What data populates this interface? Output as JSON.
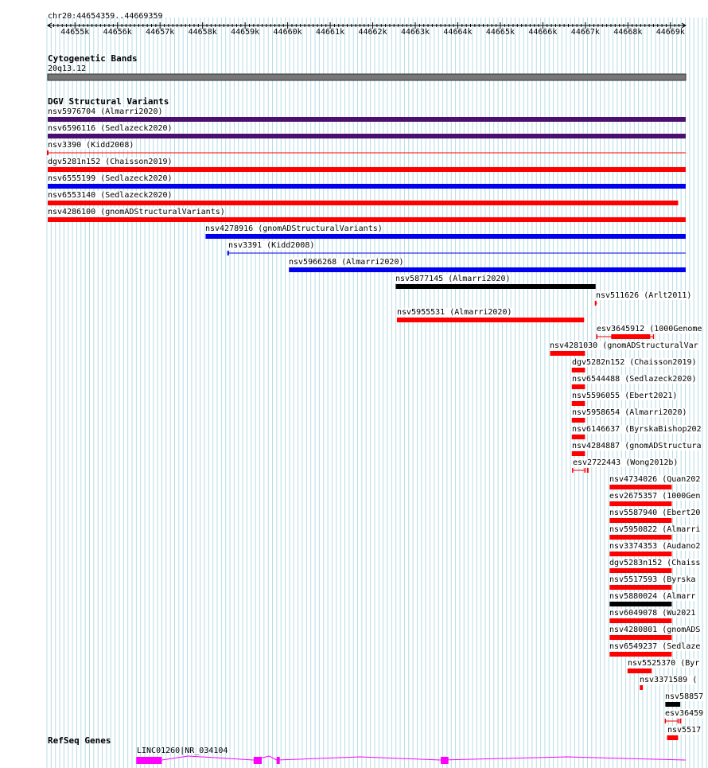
{
  "ruler": {
    "locus": "chr20:44654359..44669359",
    "start": 44654359,
    "end": 44669359,
    "ticks": [
      "44655k",
      "44656k",
      "44657k",
      "44658k",
      "44659k",
      "44660k",
      "44661k",
      "44662k",
      "44663k",
      "44664k",
      "44665k",
      "44666k",
      "44667k",
      "44668k",
      "44669k"
    ]
  },
  "cytobands": {
    "title": "Cytogenetic Bands",
    "band": "20q13.12"
  },
  "dgv": {
    "title": "DGV Structural Variants",
    "features": [
      {
        "label": "nsv5976704 (Almarri2020)",
        "color": "#4b0f70",
        "kind": "bar",
        "start": 44654359,
        "end": 44669359
      },
      {
        "label": "nsv6596116 (Sedlazeck2020)",
        "color": "#4b0f70",
        "kind": "bar",
        "start": 44654359,
        "end": 44669359
      },
      {
        "label": "nsv3390 (Kidd2008)",
        "color": "#ff0000",
        "kind": "line",
        "start": 44654359,
        "end": 44669359
      },
      {
        "label": "dgv5281n152 (Chaisson2019)",
        "color": "#ff0000",
        "kind": "bar",
        "start": 44654359,
        "end": 44669359
      },
      {
        "label": "nsv6555199 (Sedlazeck2020)",
        "color": "#0000ee",
        "kind": "bar",
        "start": 44654359,
        "end": 44669359
      },
      {
        "label": "nsv6553140 (Sedlazeck2020)",
        "color": "#ff0000",
        "kind": "bar",
        "start": 44654359,
        "end": 44669180
      },
      {
        "label": "nsv4286100 (gnomADStructuralVariants)",
        "color": "#ff0000",
        "kind": "bar",
        "start": 44654359,
        "end": 44669359
      },
      {
        "label": "nsv4278916 (gnomADStructuralVariants)",
        "color": "#0000ee",
        "kind": "bar",
        "start": 44658070,
        "end": 44669359
      },
      {
        "label": "nsv3391 (Kidd2008)",
        "color": "#0000ee",
        "kind": "line",
        "start": 44658600,
        "end": 44669359
      },
      {
        "label": "nsv5966268 (Almarri2020)",
        "color": "#0000ee",
        "kind": "bar",
        "start": 44660030,
        "end": 44669359
      },
      {
        "label": "nsv5877145 (Almarri2020)",
        "color": "#000000",
        "kind": "bar",
        "start": 44662540,
        "end": 44667240
      },
      {
        "label": "nsv511626 (Arlt2011)",
        "color": "#ff0000",
        "kind": "line",
        "start": 44667240,
        "end": 44667280
      },
      {
        "label": "nsv5955531 (Almarri2020)",
        "color": "#ff0000",
        "kind": "bar",
        "start": 44662570,
        "end": 44666970
      },
      {
        "label": "esv3645912 (1000Genome",
        "color": "#ff0000",
        "kind": "bracket",
        "start": 44667270,
        "end": 44668600
      },
      {
        "label": "nsv4281030 (gnomADStructuralVar",
        "color": "#ff0000",
        "kind": "bar",
        "start": 44666170,
        "end": 44666990
      },
      {
        "label": "dgv5282n152 (Chaisson2019)",
        "color": "#ff0000",
        "kind": "bar",
        "start": 44666680,
        "end": 44666990
      },
      {
        "label": "nsv6544488 (Sedlazeck2020)",
        "color": "#ff0000",
        "kind": "bar",
        "start": 44666680,
        "end": 44666990
      },
      {
        "label": "nsv5596055 (Ebert2021)",
        "color": "#ff0000",
        "kind": "bar",
        "start": 44666680,
        "end": 44666990
      },
      {
        "label": "nsv5958654 (Almarri2020)",
        "color": "#ff0000",
        "kind": "bar",
        "start": 44666680,
        "end": 44666990
      },
      {
        "label": "nsv6146637 (ByrskaBishop202",
        "color": "#ff0000",
        "kind": "bar",
        "start": 44666680,
        "end": 44666990
      },
      {
        "label": "nsv4284887 (gnomADStructura",
        "color": "#ff0000",
        "kind": "bar",
        "start": 44666680,
        "end": 44666990
      },
      {
        "label": "esv2722443 (Wong2012b)",
        "color": "#ff0000",
        "kind": "bracket",
        "start": 44666700,
        "end": 44666990
      },
      {
        "label": "nsv4734026 (Quan202",
        "color": "#ff0000",
        "kind": "bar",
        "start": 44667570,
        "end": 44669030
      },
      {
        "label": "esv2675357 (1000Gen",
        "color": "#ff0000",
        "kind": "bar",
        "start": 44667570,
        "end": 44669030
      },
      {
        "label": "nsv5587940 (Ebert20",
        "color": "#ff0000",
        "kind": "bar",
        "start": 44667570,
        "end": 44669030
      },
      {
        "label": "nsv5950822 (Almarri",
        "color": "#ff0000",
        "kind": "bar",
        "start": 44667570,
        "end": 44669030
      },
      {
        "label": "nsv3374353 (Audano2",
        "color": "#ff0000",
        "kind": "bar",
        "start": 44667570,
        "end": 44669030
      },
      {
        "label": "dgv5283n152 (Chaiss",
        "color": "#ff0000",
        "kind": "bar",
        "start": 44667570,
        "end": 44669030
      },
      {
        "label": "nsv5517593 (Byrska",
        "color": "#ff0000",
        "kind": "bar",
        "start": 44667570,
        "end": 44669030
      },
      {
        "label": "nsv5880024 (Almarr",
        "color": "#000000",
        "kind": "bar",
        "start": 44667570,
        "end": 44669030
      },
      {
        "label": "nsv6049078 (Wu2021",
        "color": "#ff0000",
        "kind": "bar",
        "start": 44667570,
        "end": 44669030
      },
      {
        "label": "nsv4280801 (gnomADS",
        "color": "#ff0000",
        "kind": "bar",
        "start": 44667570,
        "end": 44669030
      },
      {
        "label": "nsv6549237 (Sedlaze",
        "color": "#ff0000",
        "kind": "bar",
        "start": 44667570,
        "end": 44669030
      },
      {
        "label": "nsv5525370 (Byr",
        "color": "#ff0000",
        "kind": "bar",
        "start": 44667990,
        "end": 44668560
      },
      {
        "label": "nsv3371589 (",
        "color": "#ff0000",
        "kind": "bar",
        "start": 44668280,
        "end": 44668350
      },
      {
        "label": "nsv58857",
        "color": "#000000",
        "kind": "bar",
        "start": 44668880,
        "end": 44669230
      },
      {
        "label": "esv36459",
        "color": "#ff0000",
        "kind": "bracket",
        "start": 44668880,
        "end": 44669180
      },
      {
        "label": "nsv5517",
        "color": "#ff0000",
        "kind": "bar",
        "start": 44668920,
        "end": 44669180
      }
    ]
  },
  "refseq": {
    "title": "RefSeq Genes",
    "gene": {
      "label": "LINC01260|NR_034104",
      "color": "#ff00ff",
      "start": 44656440,
      "end": 44669359,
      "exons": [
        [
          44656440,
          44657040
        ],
        [
          44659200,
          44659390
        ],
        [
          44659740,
          44659800
        ],
        [
          44663600,
          44663780
        ]
      ]
    }
  }
}
